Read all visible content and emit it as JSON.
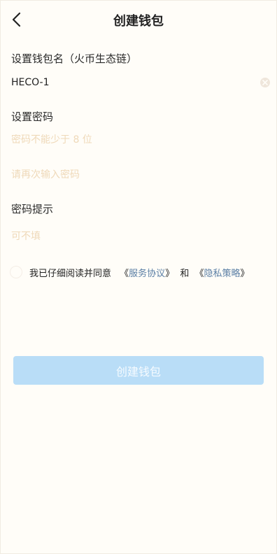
{
  "header": {
    "title": "创建钱包",
    "back_icon": "chevron-left-icon"
  },
  "wallet_name": {
    "label": "设置钱包名（火币生态链）",
    "value": "HECO-1",
    "clear_icon": "clear-icon"
  },
  "password": {
    "label": "设置密码",
    "placeholder": "密码不能少于 8 位",
    "confirm_placeholder": "请再次输入密码"
  },
  "hint": {
    "label": "密码提示",
    "placeholder": "可不填"
  },
  "agreement": {
    "prefix": "我已仔细阅读并同意",
    "open_quote_1": "《",
    "service_link": "服务协议",
    "close_quote_1": "》",
    "and": "和",
    "open_quote_2": "《",
    "privacy_link": "隐私策略",
    "close_quote_2": "》"
  },
  "actions": {
    "create_label": "创建钱包"
  },
  "colors": {
    "page_bg": "#fffdf8",
    "placeholder": "#efd9b9",
    "link": "#5b7fa5",
    "button_bg": "#b9ddf7",
    "button_text": "#f6fbff"
  }
}
